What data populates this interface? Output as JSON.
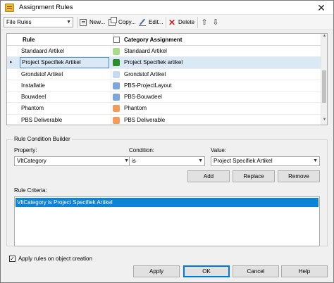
{
  "window": {
    "title": "Assignment Rules",
    "close_glyph": "✕"
  },
  "toolbar": {
    "filter_value": "File Rules",
    "new_label": "New...",
    "copy_label": "Copy...",
    "edit_label": "Edit...",
    "delete_label": "Delete",
    "move_up_glyph": "⇧",
    "move_down_glyph": "⇩"
  },
  "grid": {
    "columns": {
      "rule": "Rule",
      "category": "Category Assignment"
    },
    "rows": [
      {
        "rule": "Standaard Artikel",
        "category": "Standaard Artikel",
        "color": "#a6dc8c",
        "selected": false
      },
      {
        "rule": "Project Specifiek Artikel",
        "category": "Project Specifiek artikel",
        "color": "#2e8b2e",
        "selected": true
      },
      {
        "rule": "Grondstof Artikel",
        "category": "Grondstof Artikel",
        "color": "#c6daf2",
        "selected": false
      },
      {
        "rule": "Installatie",
        "category": "PBS-ProjectLayout",
        "color": "#7ba7dc",
        "selected": false
      },
      {
        "rule": "Bouwdeel",
        "category": "PBS-Bouwdeel",
        "color": "#7ba7dc",
        "selected": false
      },
      {
        "rule": "Phantom",
        "category": "Phantom",
        "color": "#f39a5c",
        "selected": false
      },
      {
        "rule": "PBS Deliverable",
        "category": "PBS Deliverable",
        "color": "#f39a5c",
        "selected": false
      }
    ],
    "row_indicator": "▸"
  },
  "builder": {
    "title": "Rule Condition Builder",
    "property_label": "Property:",
    "property_value": "VltCategory",
    "condition_label": "Condition:",
    "condition_value": "is",
    "value_label": "Value:",
    "value_value": "Project Specifiek Artikel",
    "add_label": "Add",
    "replace_label": "Replace",
    "remove_label": "Remove",
    "criteria_label": "Rule Criteria:",
    "criteria_items": [
      "VltCategory is Project Specifiek Artikel"
    ]
  },
  "footer": {
    "apply_on_creation_label": "Apply rules on object creation",
    "apply_on_creation_checked": true,
    "apply_label": "Apply",
    "ok_label": "OK",
    "cancel_label": "Cancel",
    "help_label": "Help"
  }
}
